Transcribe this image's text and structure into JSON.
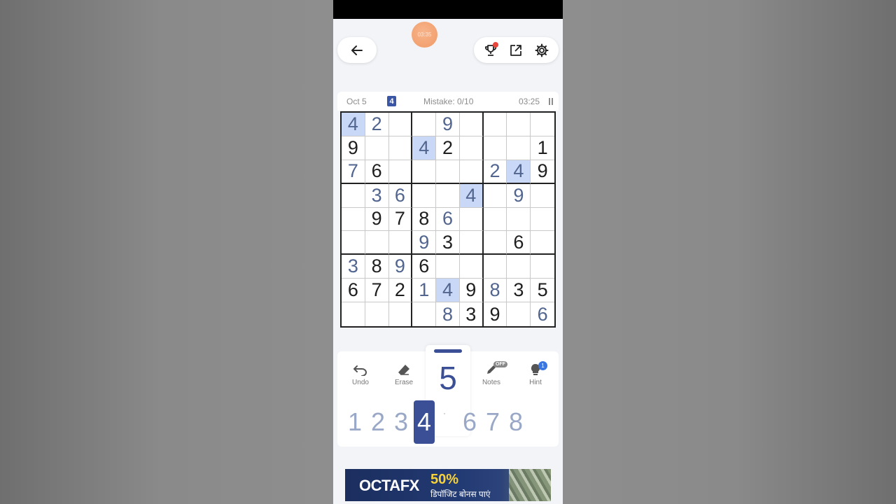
{
  "status": {
    "recording_time": "03:35"
  },
  "header": {
    "back_icon": "arrow-left-icon",
    "tools": [
      "trophy-icon",
      "share-icon",
      "gear-icon"
    ]
  },
  "info": {
    "date": "Oct 5",
    "level": "4",
    "mistake": "Mistake: 0/10",
    "time": "03:25"
  },
  "board": {
    "rows": [
      [
        "4",
        "2",
        "",
        "",
        "9",
        "",
        "",
        "",
        ""
      ],
      [
        "9",
        "",
        "",
        "4",
        "2",
        "",
        "",
        "",
        "1"
      ],
      [
        "7",
        "6",
        "",
        "",
        "",
        "",
        "2",
        "4",
        "9"
      ],
      [
        "",
        "3",
        "6",
        "",
        "",
        "4",
        "",
        "9",
        ""
      ],
      [
        "",
        "9",
        "7",
        "8",
        "6",
        "",
        "",
        "",
        ""
      ],
      [
        "",
        "",
        "",
        "9",
        "3",
        "",
        "",
        "6",
        ""
      ],
      [
        "3",
        "8",
        "9",
        "6",
        "",
        "",
        "",
        "",
        ""
      ],
      [
        "6",
        "7",
        "2",
        "1",
        "4",
        "9",
        "8",
        "3",
        "5"
      ],
      [
        "",
        "",
        "",
        "",
        "8",
        "3",
        "9",
        "",
        "6"
      ]
    ],
    "entered": [
      [
        0,
        0
      ],
      [
        0,
        1
      ],
      [
        0,
        4
      ],
      [
        1,
        3
      ],
      [
        2,
        0
      ],
      [
        2,
        6
      ],
      [
        2,
        7
      ],
      [
        3,
        1
      ],
      [
        3,
        2
      ],
      [
        3,
        5
      ],
      [
        3,
        7
      ],
      [
        4,
        4
      ],
      [
        5,
        3
      ],
      [
        6,
        0
      ],
      [
        6,
        2
      ],
      [
        7,
        3
      ],
      [
        7,
        4
      ],
      [
        7,
        6
      ],
      [
        8,
        4
      ],
      [
        8,
        8
      ]
    ],
    "highlighted": [
      [
        0,
        0
      ],
      [
        1,
        3
      ],
      [
        2,
        7
      ],
      [
        3,
        5
      ],
      [
        7,
        4
      ]
    ],
    "highlight_color": "#c9d8f7",
    "entered_color": "#51658f"
  },
  "controls": {
    "undo": "Undo",
    "erase": "Erase",
    "notes": "Notes",
    "notes_state": "OFF",
    "hint": "Hint",
    "hint_count": "1"
  },
  "selected_number": "5",
  "numpad": {
    "numbers": [
      "1",
      "2",
      "3",
      "4",
      "6",
      "7",
      "8"
    ],
    "active": "4"
  },
  "ad": {
    "brand_a": "OCTA",
    "brand_b": "FX",
    "percent": "50%",
    "subtitle": "डिपॉजिट बोनस पाएं"
  },
  "colors": {
    "accent": "#3a4f95",
    "number_muted": "#9aa8c7"
  }
}
